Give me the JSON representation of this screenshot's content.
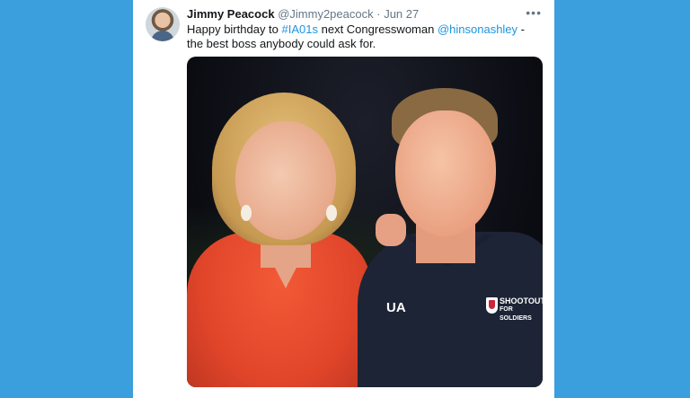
{
  "tweet": {
    "author_name": "Jimmy Peacock",
    "handle": "@Jimmy2peacock",
    "separator": "·",
    "date": "Jun 27",
    "more": "•••",
    "text": {
      "part1": "Happy birthday to ",
      "hashtag": "#IA01s",
      "part2": " next Congresswoman ",
      "mention": "@hinsonashley",
      "part3": " - the best boss anybody could ask for."
    }
  },
  "photo": {
    "logo_text": "UA",
    "shirt_text_line1": "SHOOTOUT",
    "shirt_text_line2": "FOR SOLDIERS"
  },
  "colors": {
    "page_background": "#3a9fdc",
    "card_background": "#ffffff",
    "link": "#1b95e0",
    "text_primary": "#14171a",
    "text_secondary": "#657786"
  }
}
